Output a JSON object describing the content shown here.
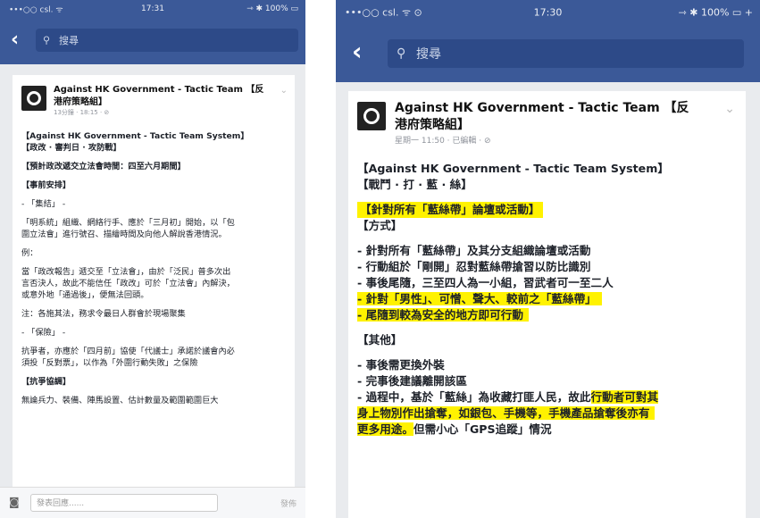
{
  "left": {
    "status": {
      "carrier": "•••○○ csl. ᯤ",
      "time": "17:31",
      "right": "⇾ ✱ 100% ▭"
    },
    "search": {
      "placeholder": "搜尋"
    },
    "post": {
      "page_name": "Against HK Government - Tactic Team 【反港府策略組】",
      "meta": "13分鐘 · 18:15 · ⊘",
      "lines": [
        {
          "t": "【Against HK Government - Tactic Team System】",
          "b": true
        },
        {
          "t": "【政改 · 審判日 · 攻防戰】",
          "b": true
        },
        {
          "gap": true
        },
        {
          "t": "【預計政改遞交立法會時間：四至六月期間】",
          "b": true
        },
        {
          "gap": true
        },
        {
          "t": "【事前安排】",
          "b": true
        },
        {
          "gap": true
        },
        {
          "t": "- 「集結」 -"
        },
        {
          "gap": true
        },
        {
          "t": "「明系統」組織、網絡行手、應於「三月初」開始，以「包"
        },
        {
          "t": "圍立法會」進行號召、描繪時間及向他人解說香港情況。"
        },
        {
          "gap": true
        },
        {
          "t": "例："
        },
        {
          "gap": true
        },
        {
          "t": "當「政改報告」遞交至「立法會」，由於「泛民」普多次出"
        },
        {
          "t": "言否決人，故此不能信任「政改」可於「立法會」內解決，"
        },
        {
          "t": "或意外地「通過後」，便無法回頭。"
        },
        {
          "gap": true
        },
        {
          "t": "注：各施其法，務求令最日人群會於現場聚集"
        },
        {
          "gap": true
        },
        {
          "t": "- 「保險」 -"
        },
        {
          "gap": true
        },
        {
          "t": "抗爭者，亦應於「四月前」協使「代議士」承諾於議會內必"
        },
        {
          "t": "須投「反對票」，以作為「外圍行動失敗」之保險"
        },
        {
          "gap": true
        },
        {
          "t": "【抗爭協調】",
          "b": true
        },
        {
          "gap": true
        },
        {
          "t": "無論兵力、裝備、陣馬設置、估計數量及範圍範圍巨大"
        }
      ]
    },
    "reply": {
      "placeholder": "發表回應......",
      "post_label": "發佈"
    }
  },
  "right": {
    "status": {
      "carrier": "•••○○ csl. ᯤ ⊙",
      "time": "17:30",
      "right": "⇾ ✱ 100% ▭ +"
    },
    "search": {
      "placeholder": "搜尋"
    },
    "post": {
      "page_name": "Against HK Government - Tactic Team 【反港府策略組】",
      "meta": "星期一 11:50 · 已編輯 · ⊘",
      "lines": [
        {
          "t": "【Against HK Government - Tactic Team System】",
          "b": true
        },
        {
          "t": "【戰鬥 · 打 · 藍 · 絲】",
          "b": true
        },
        {
          "gap": true
        },
        {
          "t": "【針對所有「藍絲帶」論壇或活動】",
          "b": true,
          "hl": "box"
        },
        {
          "t": "【方式】",
          "b": true
        },
        {
          "gap": true
        },
        {
          "t": "- 針對所有「藍絲帶」及其分支組織論壇或活動",
          "b": true
        },
        {
          "t": "- 行動組於「剛開」忍對藍絲帶搶習以防比識別",
          "b": true
        },
        {
          "t": "- 事後尾隨，三至四人為一小組，習武者可一至二人",
          "b": true
        },
        {
          "t": "- 針對「男性」、可憎、聲大、較前之「藍絲帶」",
          "b": true,
          "hl": "line"
        },
        {
          "t": "- 尾隨到較為安全的地方即可行動",
          "b": true,
          "hl": "line"
        },
        {
          "gap": true
        },
        {
          "t": "【其他】",
          "b": true
        },
        {
          "gap": true
        },
        {
          "t": "- 事後需更換外裝",
          "b": true
        },
        {
          "t": "- 完事後建議離開該區",
          "b": true
        },
        {
          "t": "- 過程中，基於「藍絲」為收藏打匪人民，故此",
          "b": true,
          "tail": "行動者可對其"
        },
        {
          "t": "身上物別作出搶奪，如銀包、手機等，手機產品搶奪後亦有",
          "b": true,
          "hl": "line"
        },
        {
          "t": "更多用途。",
          "b": true,
          "hl_part": "更多用途。",
          "rest": "但需小心「GPS追蹤」情況"
        }
      ]
    }
  }
}
